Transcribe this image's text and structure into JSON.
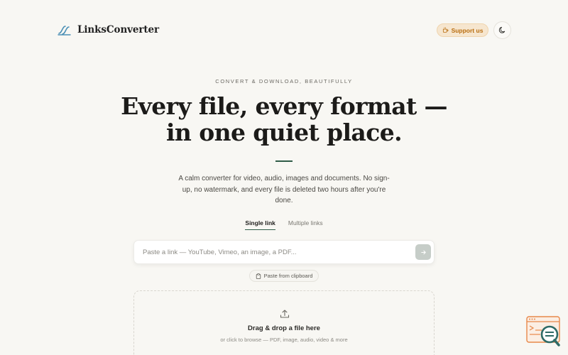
{
  "header": {
    "brand": "LinksConverter",
    "support_label": "Support us"
  },
  "hero": {
    "eyebrow": "CONVERT & DOWNLOAD, BEAUTIFULLY",
    "headline_line1": "Every file, every format —",
    "headline_line2": "in one quiet place.",
    "lead": "A calm converter for video, audio, images and documents. No sign-up, no watermark, and every file is deleted two hours after you're done."
  },
  "tabs": [
    {
      "label": "Single link",
      "active": true
    },
    {
      "label": "Multiple links",
      "active": false
    }
  ],
  "link_input": {
    "placeholder": "Paste a link — YouTube, Vimeo, an image, a PDF...",
    "value": ""
  },
  "paste_label": "Paste from clipboard",
  "dropzone": {
    "title": "Drag & drop a file here",
    "subtitle": "or click to browse — PDF, image, audio, video & more"
  },
  "colors": {
    "background": "#f8f7f3",
    "accent": "#2f5b47",
    "support": "#b96e10",
    "widget": "#e8884a"
  },
  "icons": {
    "logo": "links-logo-icon",
    "support": "coffee-icon",
    "theme": "moon-icon",
    "submit": "arrow-right-icon",
    "paste": "clipboard-icon",
    "upload": "upload-icon",
    "widget": "search-chat-widget-icon"
  }
}
